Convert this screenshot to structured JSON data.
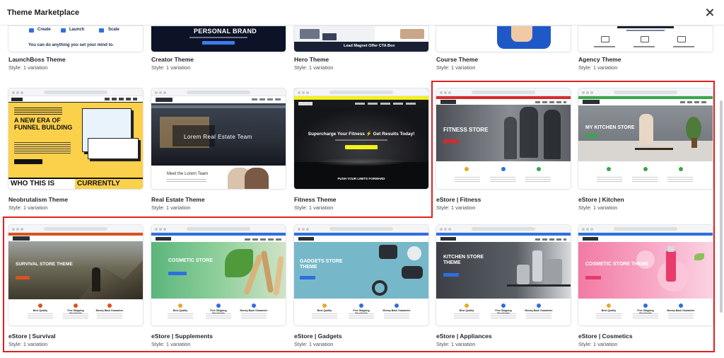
{
  "modal": {
    "title": "Theme Marketplace"
  },
  "themes_row1": [
    {
      "name": "LaunchBoss Theme",
      "style": "Style: 1 variation",
      "preview": {
        "words": [
          "Create",
          "Launch",
          "Scale"
        ],
        "tagline": "You can do anything you set your mind to."
      }
    },
    {
      "name": "Creator Theme",
      "style": "Style: 1 variation",
      "preview": {
        "headline": "PERSONAL BRAND"
      }
    },
    {
      "name": "Hero Theme",
      "style": "Style: 1 variation",
      "preview": {
        "headline": "Lead Magnet Offer CTA Box"
      }
    },
    {
      "name": "Course Theme",
      "style": "Style: 1 variation",
      "preview": {}
    },
    {
      "name": "Agency Theme",
      "style": "Style: 1 variation",
      "preview": {}
    }
  ],
  "themes_row2": [
    {
      "name": "Neobrutalism Theme",
      "style": "Style: 1 variation",
      "preview": {
        "headline": "A NEW ERA OF FUNNEL BUILDING",
        "footer_left": "WHO THIS IS",
        "footer_right": "CURRENTLY"
      }
    },
    {
      "name": "Real Estate Theme",
      "style": "Style: 1 variation",
      "preview": {
        "headline": "Lorem Real Estate Team",
        "sub": "Meet the Lorem Team"
      }
    },
    {
      "name": "Fitness Theme",
      "style": "Style: 1 variation",
      "preview": {
        "headline": "Supercharge Your Fitness ⚡ Get Results Today!",
        "footer": "PUSH YOUR LIMITS FORWARD"
      }
    },
    {
      "name": "eStore | Fitness",
      "style": "Style: 1 variation",
      "preview": {
        "headline": "FITNESS STORE"
      }
    },
    {
      "name": "eStore | Kitchen",
      "style": "Style: 1 variation",
      "preview": {
        "headline": "MY KITCHEN STORE"
      }
    }
  ],
  "themes_row3": [
    {
      "name": "eStore | Survival",
      "style": "Style: 1 variation",
      "preview": {
        "headline": "SURVIVAL STORE THEME",
        "features": [
          "Best Quality",
          "Free Shipping Worldwide",
          "Money Back Guarantee"
        ]
      }
    },
    {
      "name": "eStore | Supplements",
      "style": "Style: 1 variation",
      "preview": {
        "headline": "COSMETIC STORE",
        "features": [
          "Best Quality",
          "Free Shipping Worldwide",
          "Money-Back Guarantee"
        ]
      }
    },
    {
      "name": "eStore | Gadgets",
      "style": "Style: 1 variation",
      "preview": {
        "headline": "GADGETS STORE THEME",
        "features": [
          "Best Quality",
          "Free Shipping Worldwide",
          "Money-Back Guarantee"
        ]
      }
    },
    {
      "name": "eStore | Appliances",
      "style": "Style: 1 variation",
      "preview": {
        "headline": "KITCHEN STORE THEME",
        "features": [
          "Best Quality",
          "Free Shipping Worldwide",
          "Money-Back Guarantee"
        ]
      }
    },
    {
      "name": "eStore | Cosmetics",
      "style": "Style: 1 variation",
      "preview": {
        "headline": "COSMETIC STORE THEME",
        "features": [
          "Best Quality",
          "Free Shipping Worldwide",
          "Money-Back Guarantee"
        ]
      }
    }
  ],
  "colors": {
    "selection": "#e02020",
    "store_red": "#d62a2a",
    "store_green": "#3aa64a",
    "store_blue": "#2d6fe0"
  }
}
